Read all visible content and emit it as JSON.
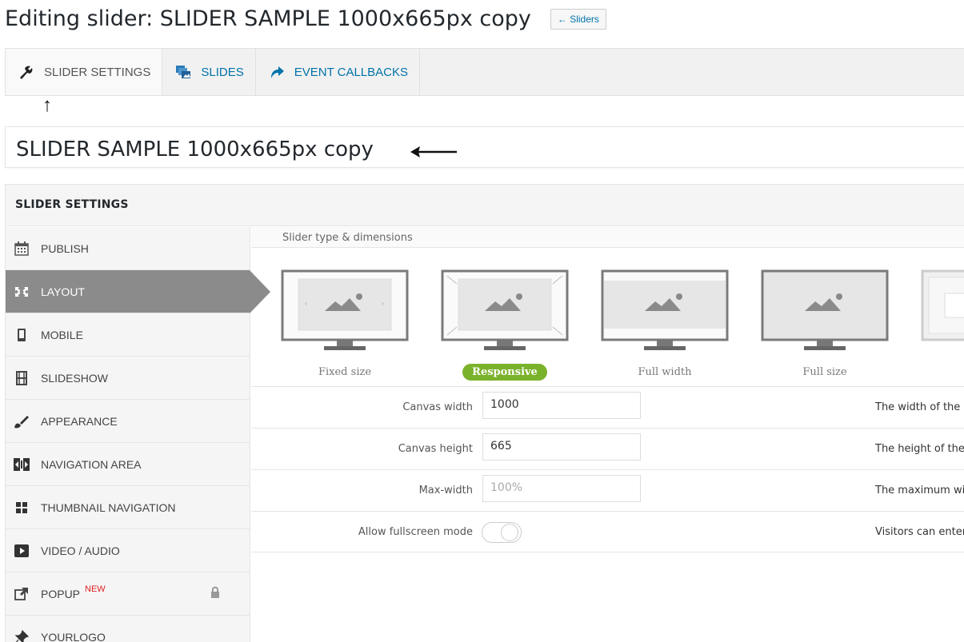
{
  "page": {
    "title": "Editing slider: SLIDER SAMPLE 1000x665px copy",
    "back_label": "← Sliders"
  },
  "tabs": [
    {
      "label": "SLIDER SETTINGS",
      "icon": "wrench-icon",
      "active": true
    },
    {
      "label": "SLIDES",
      "icon": "slides-icon",
      "active": false
    },
    {
      "label": "EVENT CALLBACKS",
      "icon": "share-arrow-icon",
      "active": false
    }
  ],
  "slider_name": "SLIDER SAMPLE 1000x665px copy",
  "panel_title": "SLIDER SETTINGS",
  "sidebar": {
    "items": [
      {
        "label": "PUBLISH",
        "icon": "calendar-icon",
        "active": false
      },
      {
        "label": "LAYOUT",
        "icon": "expand-arrows-icon",
        "active": true
      },
      {
        "label": "MOBILE",
        "icon": "mobile-icon",
        "active": false
      },
      {
        "label": "SLIDESHOW",
        "icon": "film-icon",
        "active": false
      },
      {
        "label": "APPEARANCE",
        "icon": "brush-icon",
        "active": false
      },
      {
        "label": "NAVIGATION AREA",
        "icon": "navigation-arrows-icon",
        "active": false
      },
      {
        "label": "THUMBNAIL NAVIGATION",
        "icon": "grid-icon",
        "active": false
      },
      {
        "label": "VIDEO / AUDIO",
        "icon": "play-icon",
        "active": false
      },
      {
        "label": "POPUP",
        "icon": "external-link-icon",
        "active": false,
        "badge": "NEW",
        "locked": true
      },
      {
        "label": "YOURLOGO",
        "icon": "pin-icon",
        "active": false
      }
    ]
  },
  "section_label": "Slider type & dimensions",
  "layout_types": [
    {
      "label": "Fixed size",
      "selected": false
    },
    {
      "label": "Responsive",
      "selected": true
    },
    {
      "label": "Full width",
      "selected": false
    },
    {
      "label": "Full size",
      "selected": false
    },
    {
      "label": "",
      "selected": false
    }
  ],
  "fields": [
    {
      "label": "Canvas width",
      "value": "1000",
      "placeholder": false,
      "desc": "The width of the s"
    },
    {
      "label": "Canvas height",
      "value": "665",
      "placeholder": false,
      "desc": "The height of the"
    },
    {
      "label": "Max-width",
      "value": "100%",
      "placeholder": true,
      "desc": "The maximum wic"
    }
  ],
  "fullscreen": {
    "label": "Allow fullscreen mode",
    "desc": "Visitors can enter",
    "enabled": false
  },
  "colors": {
    "accent_green": "#7bb22b",
    "link_blue": "#0073aa",
    "active_gray": "#8b8b8b"
  }
}
